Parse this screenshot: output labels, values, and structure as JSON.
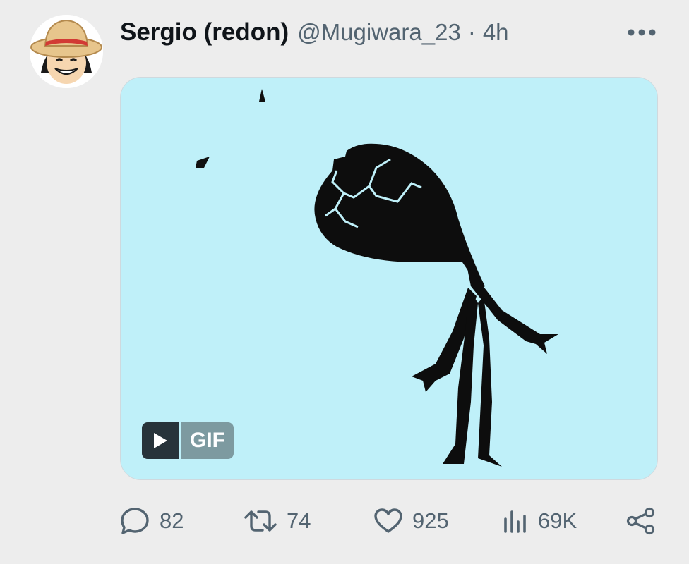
{
  "tweet": {
    "author_name": "Sergio (redon)",
    "handle": "@Mugiwara_23",
    "separator": "·",
    "time": "4h",
    "media": {
      "badge": "GIF"
    },
    "actions": {
      "replies": "82",
      "retweets": "74",
      "likes": "925",
      "views": "69K"
    }
  },
  "icons": [
    "avatar",
    "more-icon",
    "play-icon",
    "reply-icon",
    "retweet-icon",
    "like-icon",
    "views-icon",
    "share-icon"
  ],
  "colors": {
    "background": "#ededed",
    "media_background": "#bff0f9",
    "secondary_text": "#536471",
    "primary_text": "#0f1419"
  }
}
